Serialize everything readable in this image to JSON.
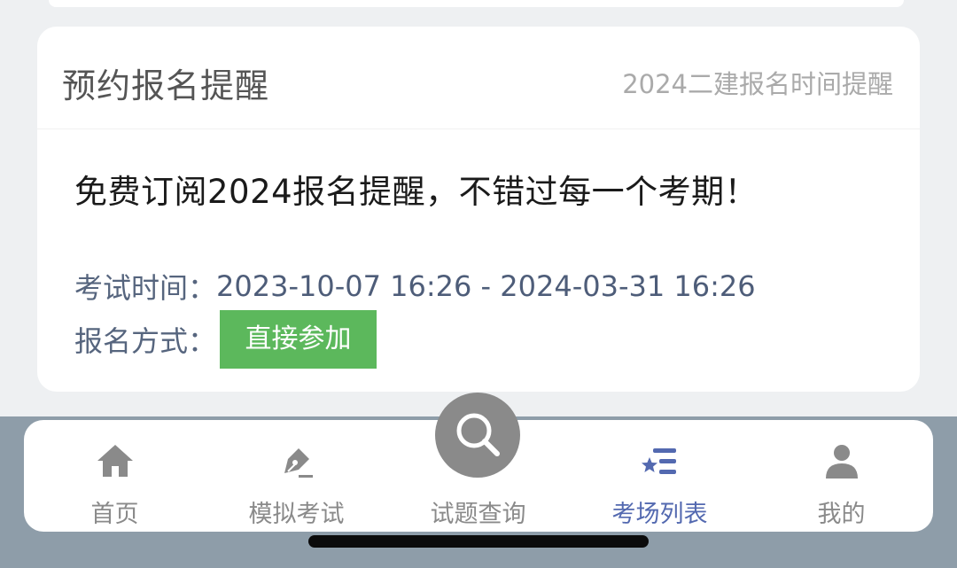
{
  "card": {
    "title": "预约报名提醒",
    "subtitle": "2024二建报名时间提醒",
    "headline": "免费订阅2024报名提醒，不错过每一个考期！",
    "exam_time_label": "考试时间：",
    "exam_time_value": "2023-10-07 16:26 - 2024-03-31 16:26",
    "method_label": "报名方式：",
    "join_button": "直接参加"
  },
  "tabbar": {
    "items": [
      {
        "label": "首页",
        "icon": "home-icon",
        "active": false
      },
      {
        "label": "模拟考试",
        "icon": "pen-icon",
        "active": false
      },
      {
        "label": "试题查询",
        "icon": "search-icon",
        "active": false
      },
      {
        "label": "考场列表",
        "icon": "star-list-icon",
        "active": true
      },
      {
        "label": "我的",
        "icon": "user-icon",
        "active": false
      }
    ]
  },
  "colors": {
    "accent": "#5369b0",
    "button_green": "#5cb85c",
    "tab_inactive": "#8a8a8a",
    "band": "#8e9da9"
  }
}
